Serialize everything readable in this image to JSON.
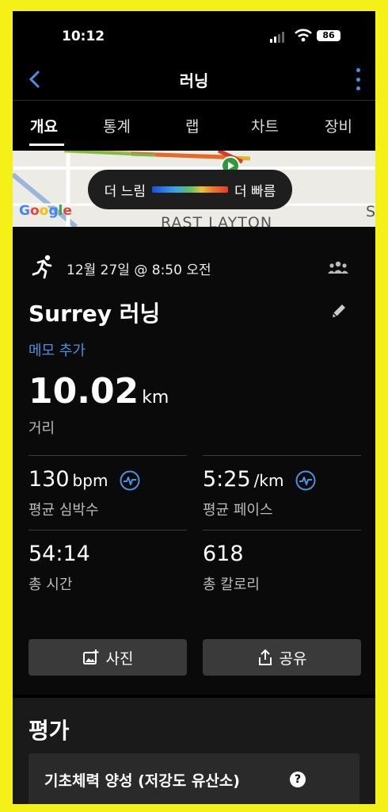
{
  "status": {
    "time": "10:12",
    "battery": "86"
  },
  "nav": {
    "title": "러닝"
  },
  "tabs": [
    "개요",
    "통계",
    "랩",
    "차트",
    "장비"
  ],
  "map": {
    "legend_slow": "더 느림",
    "legend_fast": "더 빠름",
    "google": [
      "G",
      "o",
      "o",
      "g",
      "l",
      "e"
    ],
    "google_colors": [
      "#4285f4",
      "#ea4335",
      "#fbbc05",
      "#4285f4",
      "#34a853",
      "#ea4335"
    ],
    "label_road": "RAST LAYTON",
    "label_edge": "S"
  },
  "activity": {
    "datetime": "12월 27일 @ 8:50 오전",
    "title": "Surrey 러닝",
    "memo": "메모 추가",
    "distance": {
      "value": "10.02",
      "unit": "km",
      "label": "거리"
    },
    "stats": [
      {
        "value": "130",
        "unit": "bpm",
        "label": "평균 심박수",
        "icon": "heart-rate-icon"
      },
      {
        "value": "5:25",
        "unit": "/km",
        "label": "평균 페이스",
        "icon": "pace-chart-icon"
      },
      {
        "value": "54:14",
        "unit": "",
        "label": "총 시간"
      },
      {
        "value": "618",
        "unit": "",
        "label": "총 칼로리"
      }
    ],
    "buttons": {
      "photo": "사진",
      "share": "공유"
    }
  },
  "rating": {
    "title": "평가",
    "item": "기초체력 양성 (저강도 유산소)",
    "help_icon": "?"
  },
  "colors": {
    "accent": "#4a90e2",
    "background": "#000000",
    "frame": "#f5f018"
  }
}
